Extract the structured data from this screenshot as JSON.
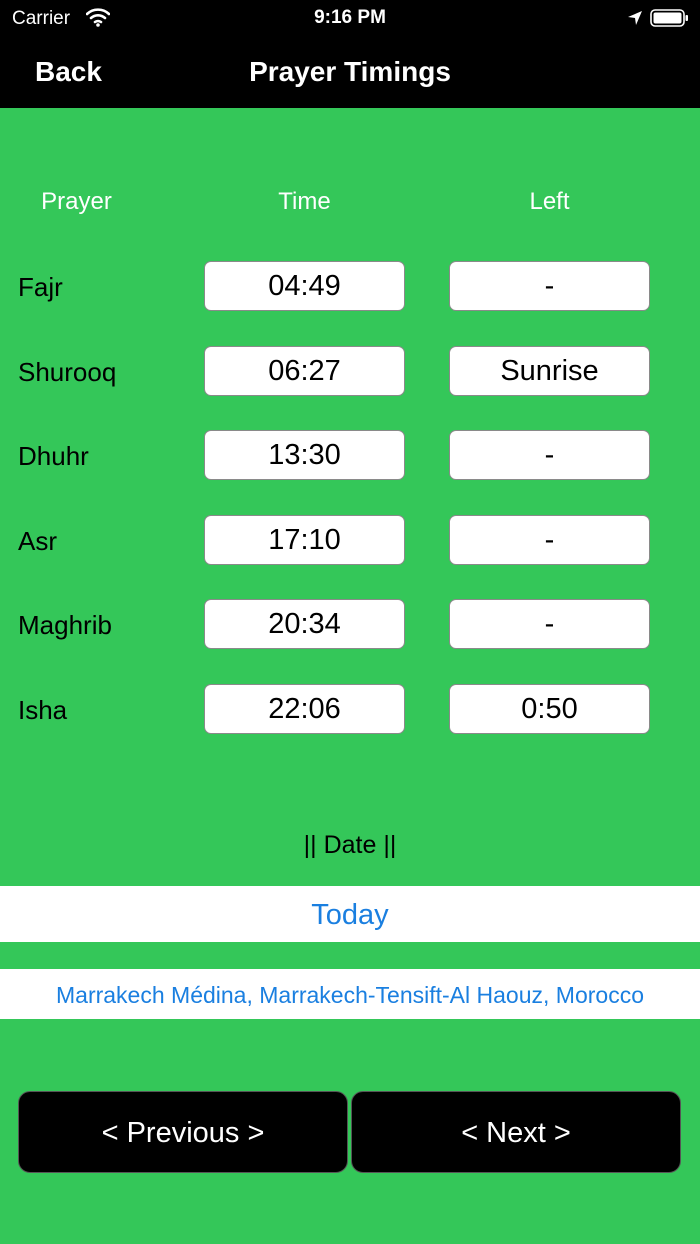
{
  "status_bar": {
    "carrier": "Carrier",
    "time": "9:16 PM"
  },
  "nav": {
    "back_label": "Back",
    "title": "Prayer Timings"
  },
  "table": {
    "headers": {
      "prayer": "Prayer",
      "time": "Time",
      "left": "Left"
    },
    "rows": [
      {
        "prayer": "Fajr",
        "time": "04:49",
        "left": "-"
      },
      {
        "prayer": "Shurooq",
        "time": "06:27",
        "left": "Sunrise"
      },
      {
        "prayer": "Dhuhr",
        "time": "13:30",
        "left": "-"
      },
      {
        "prayer": "Asr",
        "time": "17:10",
        "left": "-"
      },
      {
        "prayer": "Maghrib",
        "time": "20:34",
        "left": "-"
      },
      {
        "prayer": "Isha",
        "time": "22:06",
        "left": "0:50"
      }
    ]
  },
  "date_label": "|| Date ||",
  "today_button": "Today",
  "location": "Marrakech Médina, Marrakech-Tensift-Al Haouz, Morocco",
  "buttons": {
    "previous": "< Previous >",
    "next": "< Next >"
  },
  "colors": {
    "background": "#34c759",
    "bar": "#000000",
    "link": "#1a7fe0"
  },
  "icons": {
    "wifi": "wifi-icon",
    "location": "location-arrow-icon",
    "battery": "battery-icon"
  }
}
